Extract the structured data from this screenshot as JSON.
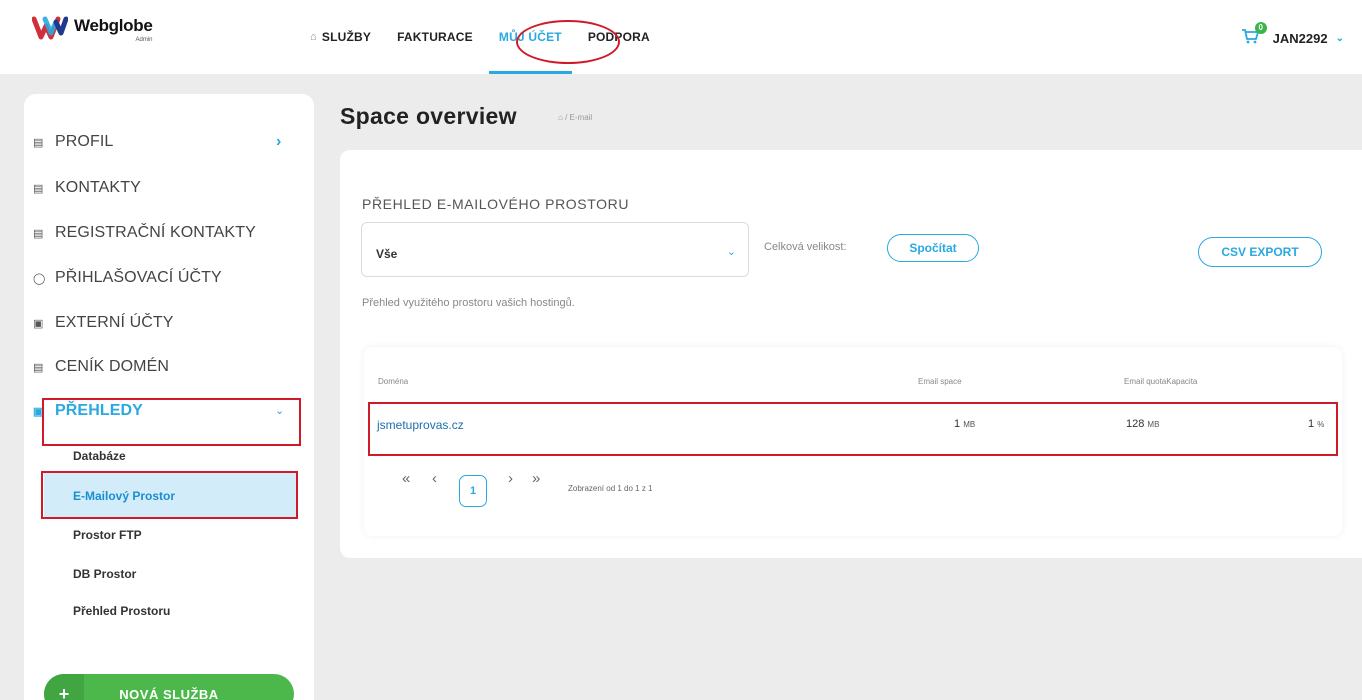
{
  "app": {
    "logo_name": "Webglobe",
    "logo_sub": "Admin",
    "brand_colors": {
      "accent": "#2aa8e0",
      "highlight": "#d01a2a",
      "success": "#4cb84c"
    }
  },
  "nav": {
    "items": [
      {
        "label": "SLUŽBY",
        "icon": "home-icon"
      },
      {
        "label": "FAKTURACE"
      },
      {
        "label": "MŮJ ÚČET",
        "active": true
      },
      {
        "label": "PODPORA"
      }
    ],
    "cart_count": "0",
    "username": "JAN2292"
  },
  "sidebar": {
    "items": [
      {
        "label": "PROFIL",
        "icon": "profile-card-icon"
      },
      {
        "label": "KONTAKTY",
        "icon": "contacts-card-icon"
      },
      {
        "label": "REGISTRAČNÍ KONTAKTY",
        "icon": "list-icon"
      },
      {
        "label": "PŘIHLAŠOVACÍ ÚČTY",
        "icon": "users-icon"
      },
      {
        "label": "EXTERNÍ ÚČTY",
        "icon": "window-icon"
      },
      {
        "label": "CENÍK DOMÉN",
        "icon": "pricelist-icon"
      },
      {
        "label": "PŘEHLEDY",
        "icon": "window-icon",
        "expanded": true
      }
    ],
    "subitems": [
      {
        "label": "Databáze"
      },
      {
        "label": "E-Mailový Prostor",
        "active": true
      },
      {
        "label": "Prostor FTP"
      },
      {
        "label": "DB Prostor"
      },
      {
        "label": "Přehled Prostoru"
      }
    ],
    "new_service_label": "NOVÁ SLUŽBA"
  },
  "page": {
    "title": "Space overview",
    "breadcrumb": "/ E-mail",
    "section_title": "PŘEHLED E-MAILOVÉHO PROSTORU",
    "select_value": "Vše",
    "total_label": "Celková velikost:",
    "compute_button": "Spočítat",
    "csv_button": "CSV EXPORT",
    "hint": "Přehled využitého prostoru vašich hostingů."
  },
  "table": {
    "headers": [
      "Doména",
      "Email space",
      "Email quotaKapacita"
    ],
    "rows": [
      {
        "domain": "jsmetuprovas.cz",
        "space": "1",
        "space_unit": "MB",
        "quota": "128",
        "quota_unit": "MB",
        "capacity": "1",
        "capacity_unit": "%"
      }
    ],
    "pager": {
      "first": "«",
      "prev": "‹",
      "current": "1",
      "next": "›",
      "last": "»",
      "info": "Zobrazení od 1 do 1 z 1"
    }
  }
}
